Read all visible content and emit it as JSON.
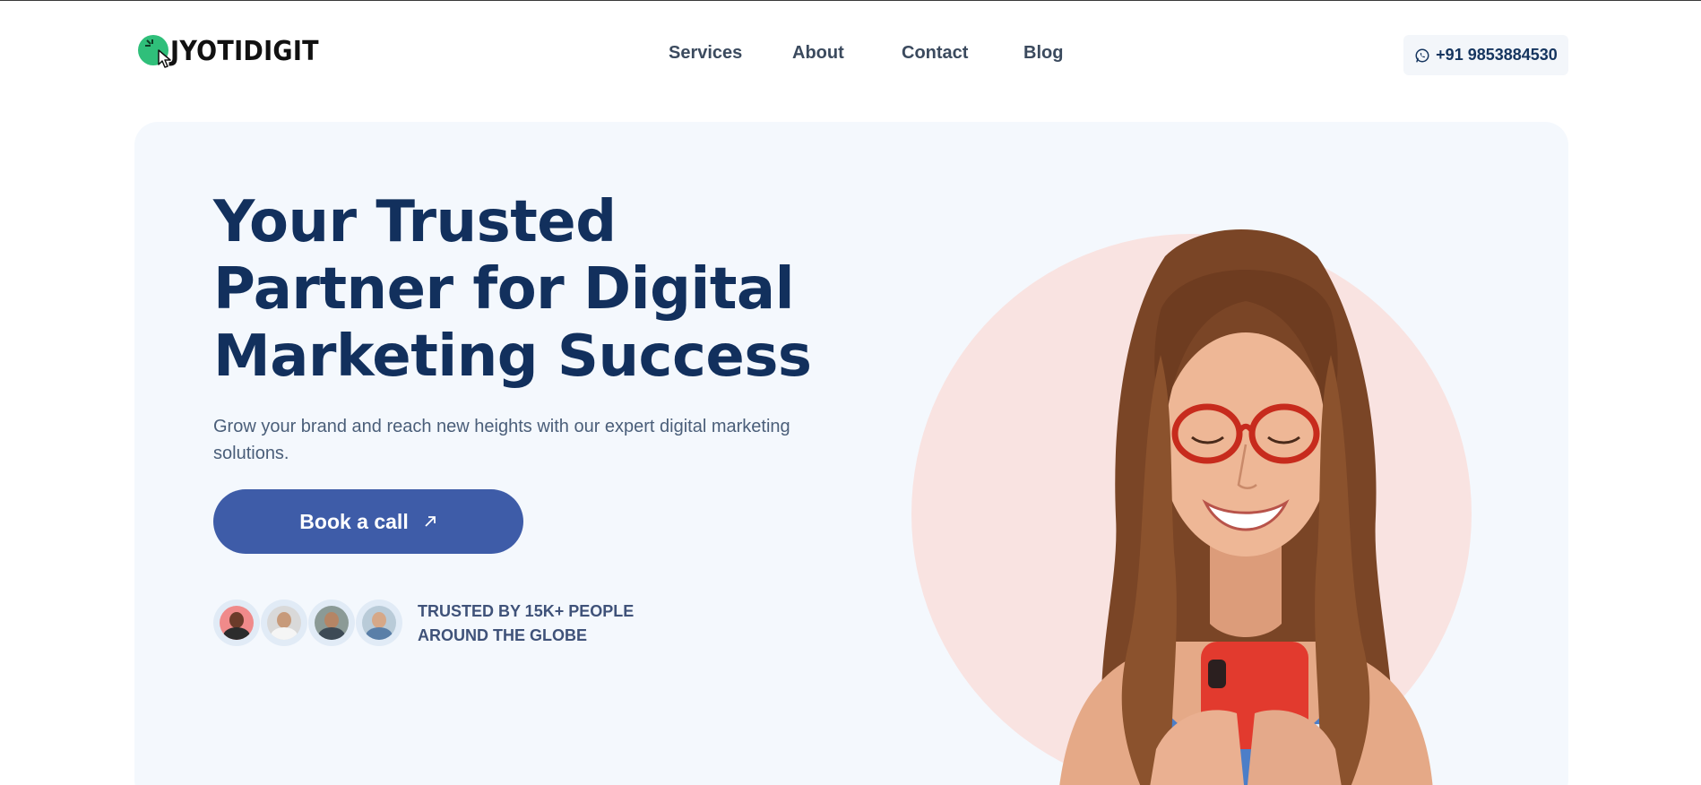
{
  "brand": {
    "name": "JYOTIDIGIT",
    "accent": "#2fbf7a"
  },
  "nav": {
    "items": [
      "Services",
      "About",
      "Contact",
      "Blog"
    ]
  },
  "contact": {
    "phone": "+91 9853884530",
    "icon": "whatsapp-icon"
  },
  "hero": {
    "title": "Your Trusted Partner for Digital Marketing Success",
    "subtitle": "Grow your brand and reach new heights with our expert digital marketing solutions.",
    "cta_label": "Book a call",
    "cta_icon": "arrow-up-right-icon",
    "trusted_line1": "TRUSTED BY 15K+ PEOPLE",
    "trusted_line2": "AROUND THE GLOBE"
  },
  "colors": {
    "heading": "#12305d",
    "cta_bg": "#3e5ca8",
    "hero_bg": "#f4f8fd",
    "circle": "#f9e3e1"
  }
}
